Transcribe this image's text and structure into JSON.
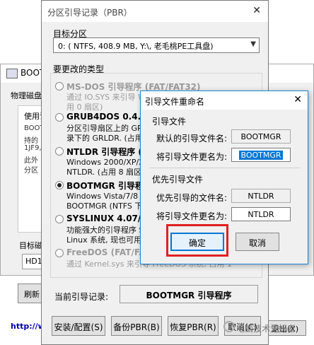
{
  "background_window": {
    "title": "BOOT",
    "tab": "物理磁盘",
    "group_label": "使用说",
    "lines": [
      "BOOT",
      "持的",
      "1JF9,",
      "此外",
      "分区"
    ],
    "target_label": "目标磁",
    "hd_value": "HD1:",
    "refresh_label": "刷新",
    "link_text": "http://w",
    "exit_label": "退出(X)"
  },
  "pbr_dialog": {
    "title": "分区引导记录（PBR）",
    "close_icon": "close-icon",
    "target_partition_label": "目标分区",
    "target_partition_value": "0: ( NTFS, 408.9 MB, Y:\\, 老毛桃PE工具盘)",
    "change_type_label": "要更改的类型",
    "options": [
      {
        "name": "MS-DOS 引导程序 (FAT/FAT32)",
        "desc": "通过 IO.SYS 来引导 Windows 9x/Me/DOS\n用 0 扇区)",
        "selected": false,
        "disabled": true
      },
      {
        "name": "GRUB4DOS 0.4.5c/0.4.6a",
        "desc": "分区引导扇区上的 GRUB4DOS 引导程序\n录下的 GRLDR. (占用 16 扇区)",
        "selected": false,
        "disabled": false
      },
      {
        "name": "NTLDR 引导程序 (FAT/FAT32/NTFS)",
        "desc": "Windows 2000/XP/2003 的引导程序\nNTLDR. (占用 8 扇区)",
        "selected": false,
        "disabled": false
      },
      {
        "name": "BOOTMGR 引导程序 (FAT/FAT32/NTFS)",
        "desc": "Windows Vista/7/8 引导程序\nBOOTMGR (NTFS 下 NTLDR)",
        "selected": true,
        "disabled": false
      },
      {
        "name": "SYSLINUX 4.07/5.10/6.03",
        "desc": "功能强大的引导程序 SYSLINUX\nLinux 系统, 现也可用于引导",
        "selected": false,
        "disabled": false
      },
      {
        "name": "FreeDOS (FAT/FAT32)",
        "desc": "通过 Kernel.sys 来引导 FreeDOS 系统, 占用 1",
        "selected": false,
        "disabled": true
      }
    ],
    "current_record_label": "当前引导记录:",
    "current_record_value": "BOOTMGR 引导程序",
    "buttons": {
      "install": "安装/配置(S)",
      "backup": "备份PBR(B)",
      "restore": "恢复PBR(R)",
      "cancel": "取消(C)"
    }
  },
  "rename_dialog": {
    "title": "引导文件重命名",
    "boot_file_section": "引导文件",
    "default_name_label": "默认的引导文件名:",
    "default_name_value": "BOOTMGR",
    "rename_to_label": "将引导文件更名为:",
    "rename_to_value": "BOOTMGR",
    "priority_section": "优先引导文件",
    "priority_name_label": "优先引导的文件名:",
    "priority_name_value": "NTLDR",
    "priority_rename_label": "将引导文件更名为:",
    "priority_rename_value": "NTLDR",
    "ok_label": "确定",
    "cancel_label": "取消",
    "highlight_color": "#e02020"
  },
  "watermark": {
    "text": "电脑技术爱好者"
  }
}
